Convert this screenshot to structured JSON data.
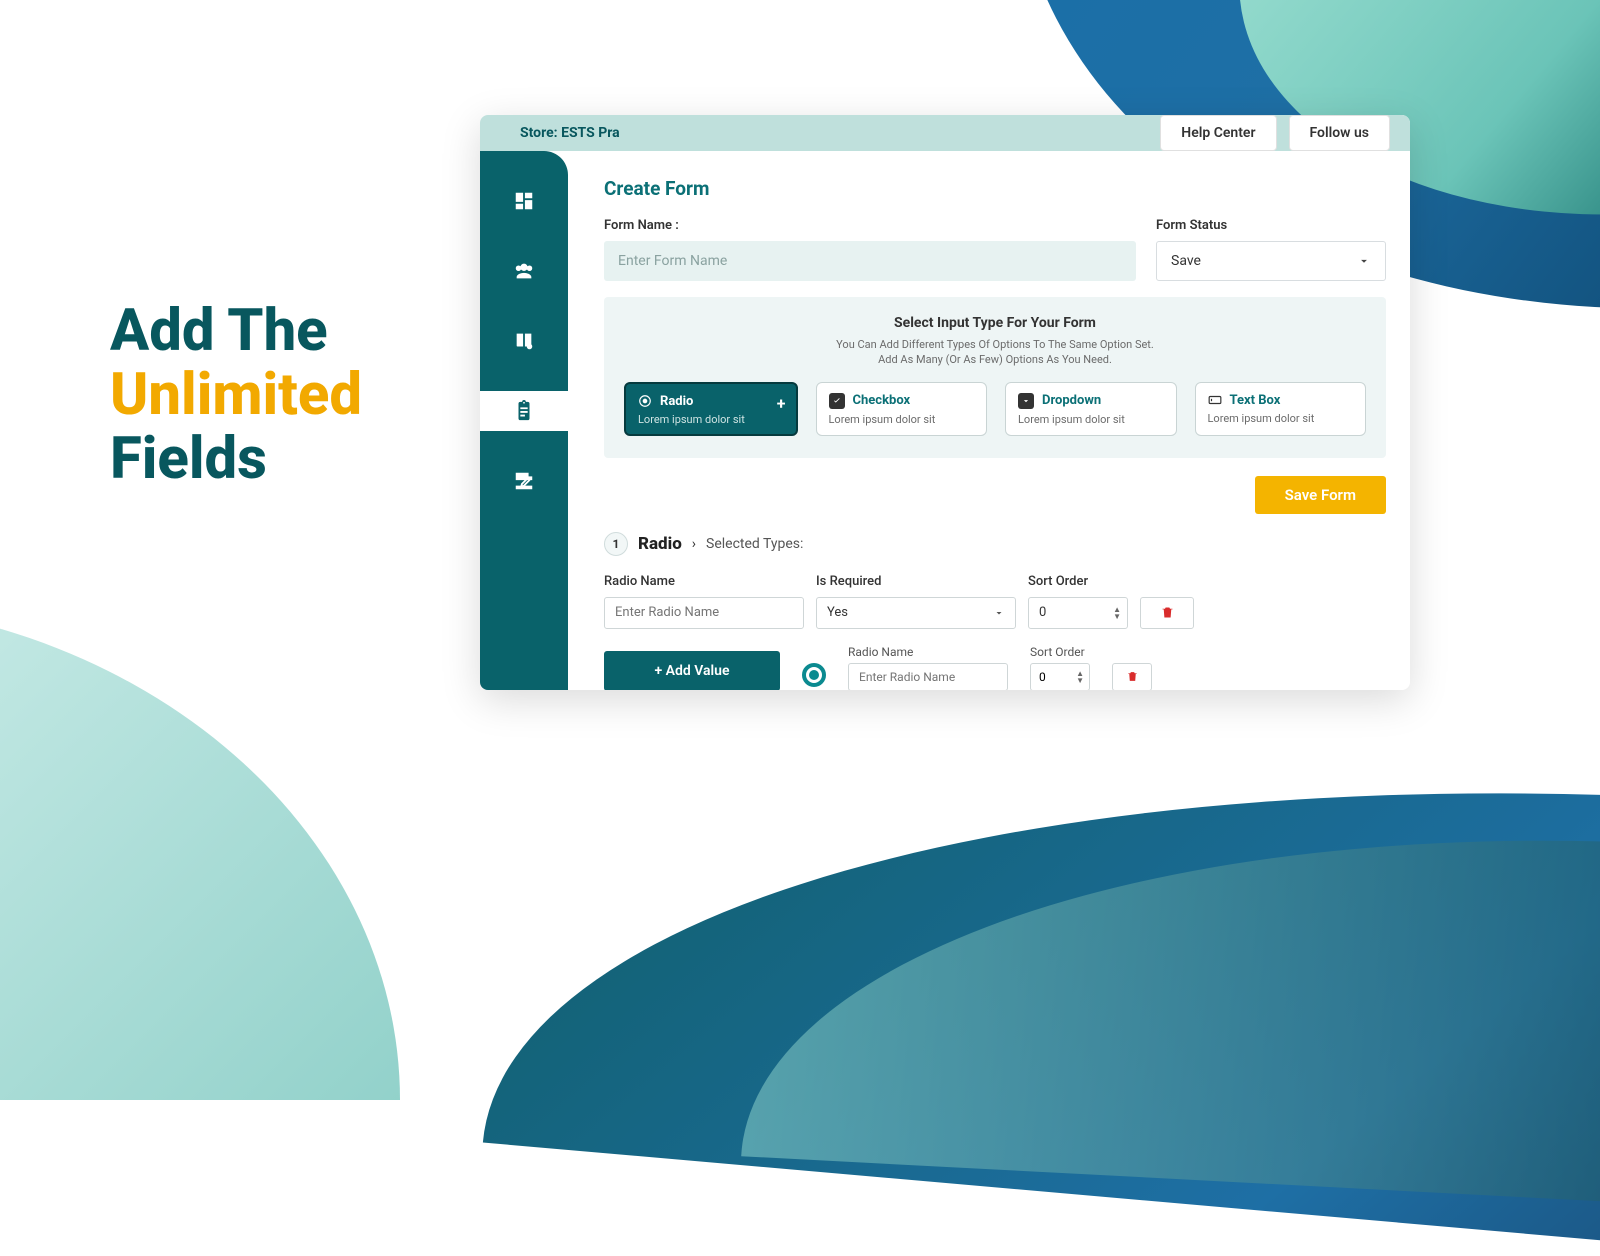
{
  "promo_headline": {
    "line1": "Add The",
    "line2": "Unlimited",
    "line3": "Fields"
  },
  "topbar": {
    "store_label_prefix": "Store: ",
    "store_name": "ESTS Pra",
    "help_center_label": "Help Center",
    "follow_label": "Follow us"
  },
  "page": {
    "title": "Create Form",
    "form_name_label": "Form Name :",
    "form_name_placeholder": "Enter Form Name",
    "form_status_label": "Form Status",
    "form_status_value": "Save"
  },
  "type_panel": {
    "title": "Select Input Type For Your Form",
    "subtitle_line1": "You Can Add Different Types Of Options To The Same Option Set.",
    "subtitle_line2": "Add As Many (Or As Few) Options As You Need.",
    "options": [
      {
        "label": "Radio",
        "desc": "Lorem ipsum dolor sit",
        "selected": true
      },
      {
        "label": "Checkbox",
        "desc": "Lorem ipsum dolor sit",
        "selected": false
      },
      {
        "label": "Dropdown",
        "desc": "Lorem ipsum dolor sit",
        "selected": false
      },
      {
        "label": "Text Box",
        "desc": "Lorem ipsum dolor sit",
        "selected": false
      }
    ]
  },
  "actions": {
    "save_form_label": "Save Form",
    "add_value_label": "+  Add Value"
  },
  "selected_section": {
    "index": "1",
    "title": "Radio",
    "subtitle": "Selected Types:",
    "radio_name_label": "Radio Name",
    "radio_name_placeholder": "Enter Radio Name",
    "is_required_label": "Is Required",
    "is_required_value": "Yes",
    "sort_order_label": "Sort Order",
    "sort_order_value": "0",
    "value_row": {
      "radio_name_label": "Radio Name",
      "radio_name_placeholder": "Enter Radio Name",
      "sort_order_label": "Sort Order",
      "sort_order_value": "0"
    }
  }
}
